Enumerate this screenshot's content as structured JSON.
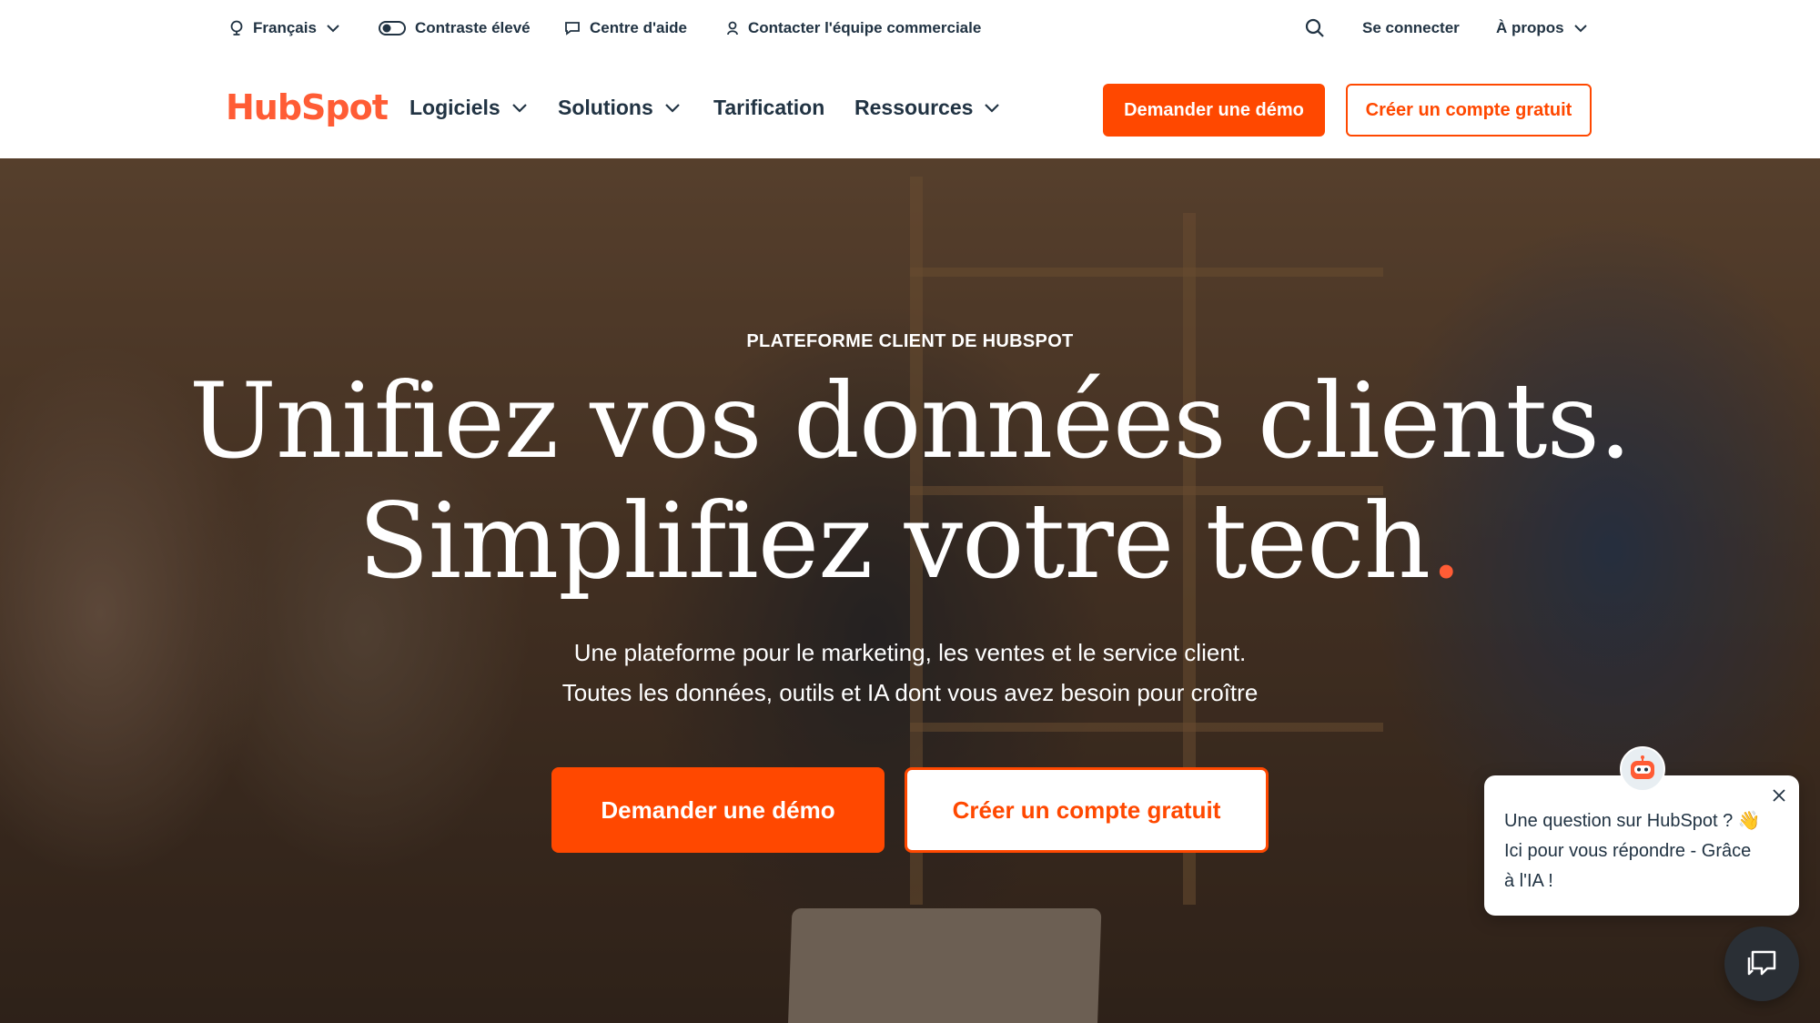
{
  "utility_bar": {
    "language": "Français",
    "contrast": "Contraste élevé",
    "help": "Centre d'aide",
    "contact_sales": "Contacter l'équipe commerciale",
    "login": "Se connecter",
    "about": "À propos"
  },
  "nav": {
    "logo": "HubSpot",
    "items": [
      {
        "label": "Logiciels",
        "dropdown": true
      },
      {
        "label": "Solutions",
        "dropdown": true
      },
      {
        "label": "Tarification",
        "dropdown": false
      },
      {
        "label": "Ressources",
        "dropdown": true
      }
    ],
    "demo_button": "Demander une démo",
    "free_account_button": "Créer un compte gratuit"
  },
  "hero": {
    "eyebrow": "PLATEFORME CLIENT DE HUBSPOT",
    "headline_line1": "Unifiez vos données clients.",
    "headline_line2": "Simplifiez votre tech",
    "headline_accent": ".",
    "subtitle_line1": "Une plateforme pour le marketing, les ventes et le service client.",
    "subtitle_line2": "Toutes les données, outils et IA dont vous avez besoin pour croître",
    "demo_button": "Demander une démo",
    "free_account_button": "Créer un compte gratuit"
  },
  "chat": {
    "line1": "Une question sur HubSpot ? 👋",
    "line2": "Ici pour vous répondre - Grâce",
    "line3": "à l'IA !"
  },
  "colors": {
    "brand_orange": "#ff4800",
    "logo_orange": "#ff5c35",
    "text_dark": "#213343"
  },
  "icons": {
    "language": "globe-icon",
    "contrast": "toggle-icon",
    "help": "chat-icon",
    "contact": "person-icon",
    "search": "search-icon",
    "chevron": "chevron-down-icon",
    "close": "close-icon",
    "bot": "robot-icon",
    "launcher": "chat-bubbles-icon"
  }
}
